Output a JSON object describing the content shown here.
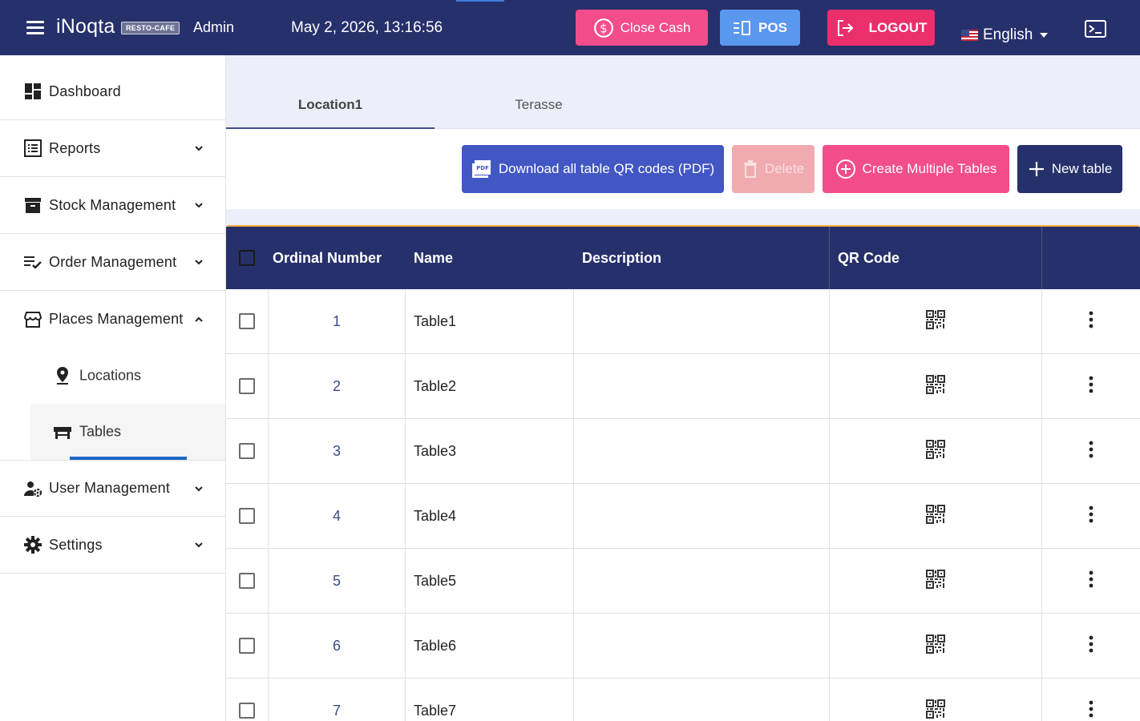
{
  "header": {
    "brand": "iNoqta",
    "badge": "RESTO-CAFE",
    "user": "Admin",
    "datetime": "May 2, 2026, 13:16:56",
    "close_cash_label": "Close Cash",
    "pos_label": "POS",
    "logout_label": "LOGOUT",
    "language": "English",
    "colors": {
      "bar": "#26306b",
      "close_cash": "#f34d8b",
      "pos": "#5a97ee",
      "logout": "#ea2f6c"
    }
  },
  "sidebar": {
    "items": [
      {
        "label": "Dashboard",
        "icon": "dashboard-icon"
      },
      {
        "label": "Reports",
        "icon": "list-icon"
      },
      {
        "label": "Stock Management",
        "icon": "archive-icon"
      },
      {
        "label": "Order Management",
        "icon": "checklist-icon"
      },
      {
        "label": "Places Management",
        "icon": "store-icon"
      },
      {
        "label": "User Management",
        "icon": "users-cog-icon"
      },
      {
        "label": "Settings",
        "icon": "gear-icon"
      }
    ],
    "subitems": [
      {
        "label": "Locations",
        "icon": "location-pin-icon"
      },
      {
        "label": "Tables",
        "icon": "table-furniture-icon",
        "active": true
      }
    ]
  },
  "tabs": [
    {
      "label": "Location1",
      "active": true
    },
    {
      "label": "Terasse",
      "active": false
    }
  ],
  "toolbar": {
    "download_label": "Download all table QR codes (PDF)",
    "delete_label": "Delete",
    "multi_label": "Create Multiple Tables",
    "new_label": "New table"
  },
  "table": {
    "columns": [
      "Ordinal Number",
      "Name",
      "Description",
      "QR Code"
    ],
    "rows": [
      {
        "ordinal": "1",
        "name": "Table1",
        "description": ""
      },
      {
        "ordinal": "2",
        "name": "Table2",
        "description": ""
      },
      {
        "ordinal": "3",
        "name": "Table3",
        "description": ""
      },
      {
        "ordinal": "4",
        "name": "Table4",
        "description": ""
      },
      {
        "ordinal": "5",
        "name": "Table5",
        "description": ""
      },
      {
        "ordinal": "6",
        "name": "Table6",
        "description": ""
      },
      {
        "ordinal": "7",
        "name": "Table7",
        "description": ""
      }
    ]
  }
}
